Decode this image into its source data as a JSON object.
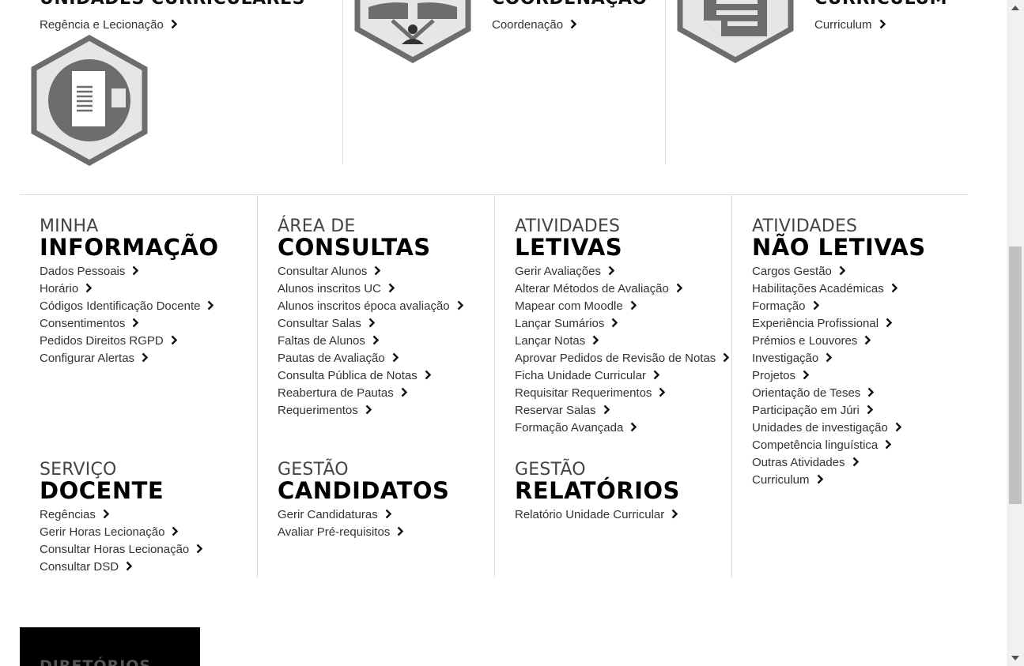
{
  "top": [
    {
      "title": "UNIDADES CURRICULARES",
      "link": "Regência e Lecionação"
    },
    {
      "title": "COORDENAÇÃO",
      "link": "Coordenação"
    },
    {
      "title": "CURRICULUM",
      "link": "Curriculum"
    }
  ],
  "sections": {
    "minha_informacao": {
      "h1": "MINHA",
      "h2": "INFORMAÇÃO",
      "items": [
        "Dados Pessoais",
        "Horário",
        "Códigos Identificação Docente",
        "Consentimentos",
        "Pedidos Direitos RGPD",
        "Configurar Alertas"
      ]
    },
    "area_consultas": {
      "h1": "ÁREA DE",
      "h2": "CONSULTAS",
      "items": [
        "Consultar Alunos",
        "Alunos inscritos UC",
        "Alunos inscritos época avaliação",
        "Consultar Salas",
        "Faltas de Alunos",
        "Pautas de Avaliação",
        "Consulta Pública de Notas",
        "Reabertura de Pautas",
        "Requerimentos"
      ]
    },
    "atividades_letivas": {
      "h1": "ATIVIDADES",
      "h2": "LETIVAS",
      "items": [
        "Gerir Avaliações",
        "Alterar Métodos de Avaliação",
        "Mapear com Moodle",
        "Lançar Sumários",
        "Lançar Notas",
        "Aprovar Pedidos de Revisão de Notas",
        "Ficha Unidade Curricular",
        "Requisitar Requerimentos",
        "Reservar Salas",
        "Formação Avançada"
      ]
    },
    "atividades_nao_letivas": {
      "h1": "ATIVIDADES",
      "h2": "NÃO LETIVAS",
      "items": [
        "Cargos Gestão",
        "Habilitações Académicas",
        "Formação",
        "Experiência Profissional",
        "Prémios e Louvores",
        "Investigação",
        "Projetos",
        "Orientação de Teses",
        "Participação em Júri",
        "Unidades de investigação",
        "Competência linguística",
        "Outras Atividades",
        "Curriculum"
      ]
    },
    "servico_docente": {
      "h1": "SERVIÇO",
      "h2": "DOCENTE",
      "items": [
        "Regências",
        "Gerir Horas Lecionação",
        "Consultar Horas Lecionação",
        "Consultar DSD"
      ]
    },
    "gestao_candidatos": {
      "h1": "GESTÃO",
      "h2": "CANDIDATOS",
      "items": [
        "Gerir Candidaturas",
        "Avaliar Pré-requisitos"
      ]
    },
    "gestao_relatorios": {
      "h1": "GESTÃO",
      "h2": "RELATÓRIOS",
      "items": [
        "Relatório Unidade Curricular"
      ]
    }
  },
  "footer_block": {
    "title": "DIRETÓRIOS"
  },
  "colors": {
    "icon_gray": "#6d6d6d",
    "icon_light": "#e6e6e6",
    "divider": "#dcdcdc",
    "black": "#000000"
  }
}
